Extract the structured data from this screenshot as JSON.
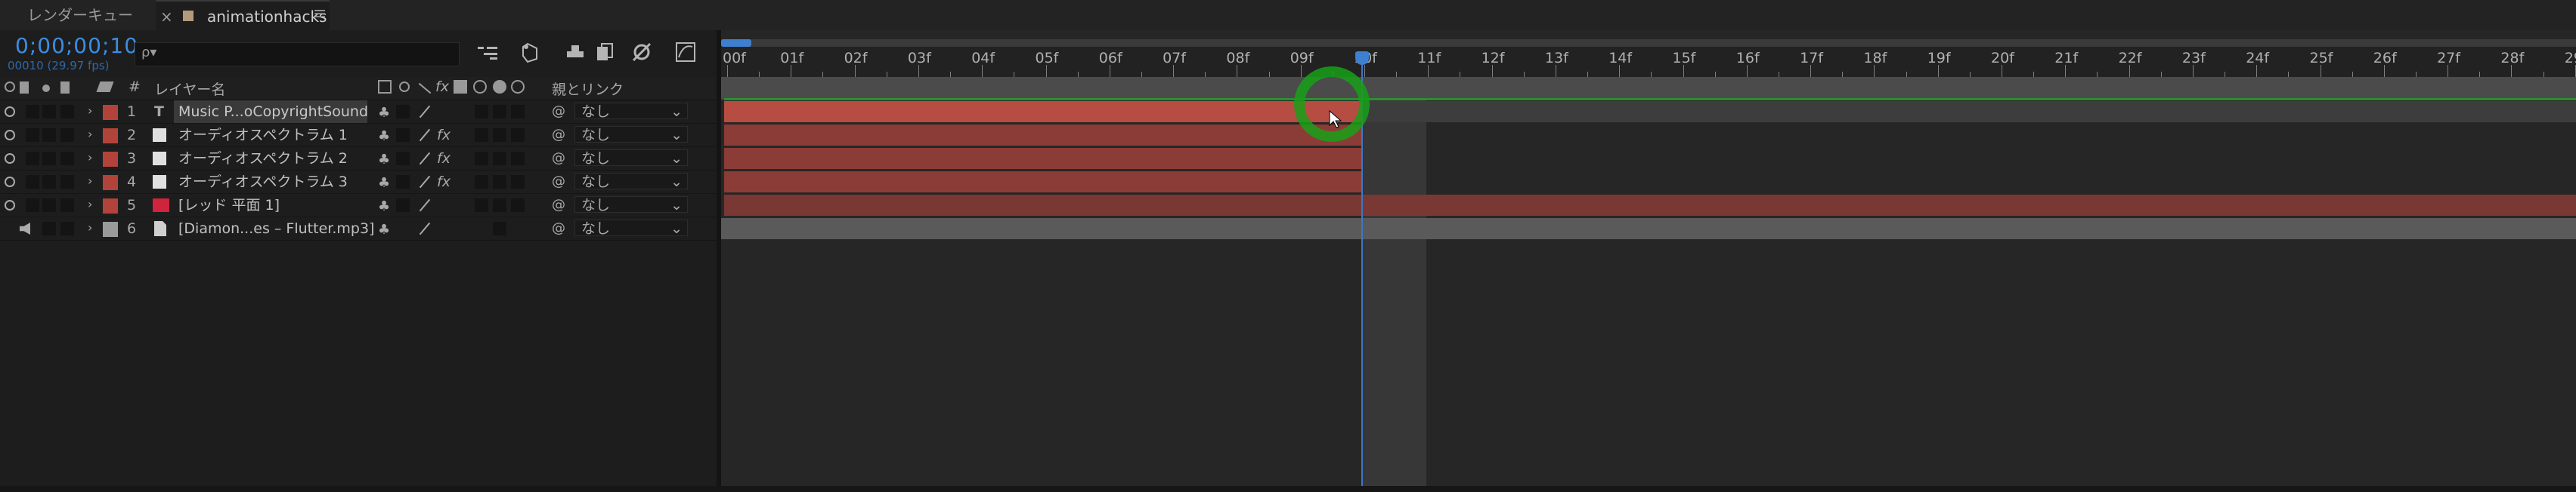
{
  "tabs": [
    {
      "label": "レンダーキュー",
      "closable": false
    },
    {
      "label": "animationhacks",
      "closable": true,
      "active": true
    }
  ],
  "tab_close": "×",
  "tab_menu": "≡",
  "timecode": "0;00;00;10",
  "fps_text": "00010 (29.97 fps)",
  "search": {
    "placeholder": "ρ▾"
  },
  "columns": {
    "num": "#",
    "layer_name": "レイヤー名",
    "parent": "親とリンク"
  },
  "layers": [
    {
      "num": "1",
      "type": "T",
      "name": "Music P...oCopyrightSounds",
      "color": "#b2433a",
      "fx": "",
      "parent": "なし",
      "selected": true,
      "audio": false
    },
    {
      "num": "2",
      "type": "",
      "name": "オーディオスペクトラム 1",
      "color": "#b2433a",
      "fx": "fx",
      "parent": "なし",
      "selected": false,
      "audio": false
    },
    {
      "num": "3",
      "type": "",
      "name": "オーディオスペクトラム 2",
      "color": "#b2433a",
      "fx": "fx",
      "parent": "なし",
      "selected": false,
      "audio": false
    },
    {
      "num": "4",
      "type": "",
      "name": "オーディオスペクトラム 3",
      "color": "#b2433a",
      "fx": "fx",
      "parent": "なし",
      "selected": false,
      "audio": false
    },
    {
      "num": "5",
      "type": "",
      "name": "[レッド 平面 1]",
      "color": "#b2433a",
      "fx": "",
      "parent": "なし",
      "selected": false,
      "audio": false
    },
    {
      "num": "6",
      "type": "",
      "name": "[Diamon...es – Flutter.mp3]",
      "color": "#9a9a9a",
      "fx": "",
      "parent": "なし",
      "selected": false,
      "audio": true
    }
  ],
  "ruler_labels": [
    "00f",
    "01f",
    "02f",
    "03f",
    "04f",
    "05f",
    "06f",
    "07f",
    "08f",
    "09f",
    "10f",
    "11f",
    "12f",
    "13f",
    "14f",
    "15f",
    "16f",
    "17f",
    "18f",
    "19f",
    "20f",
    "21f",
    "22f",
    "23f",
    "24f",
    "25f",
    "26f",
    "27f",
    "28f",
    "29"
  ],
  "current_frame": 10,
  "colors": {
    "accent": "#3e7fd0",
    "layer_red": "#b2433a",
    "bar_red": "#8b3c37",
    "bar_dark_red": "#7a3834",
    "audio_bar": "#5a5a5a",
    "highlight_ring": "#17a017"
  }
}
